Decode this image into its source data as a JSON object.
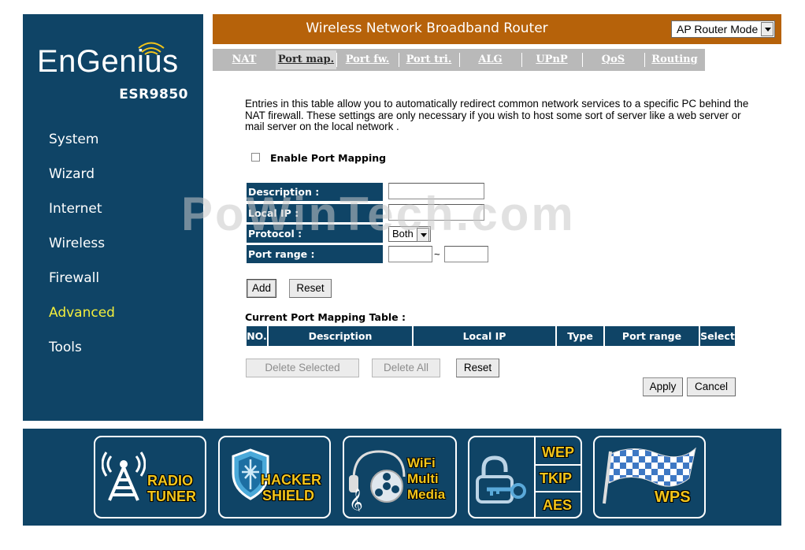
{
  "brand": {
    "logo_text": "EnGenius",
    "model": "ESR9850"
  },
  "header": {
    "title": "Wireless Network Broadband Router",
    "mode": "AP Router Mode"
  },
  "nav": {
    "items": [
      {
        "label": "System",
        "active": false
      },
      {
        "label": "Wizard",
        "active": false
      },
      {
        "label": "Internet",
        "active": false
      },
      {
        "label": "Wireless",
        "active": false
      },
      {
        "label": "Firewall",
        "active": false
      },
      {
        "label": "Advanced",
        "active": true
      },
      {
        "label": "Tools",
        "active": false
      }
    ],
    "active_color": "#f3ee3c"
  },
  "tabs": [
    {
      "label": "NAT",
      "active": false
    },
    {
      "label": "Port map.",
      "active": true
    },
    {
      "label": "Port fw.",
      "active": false
    },
    {
      "label": "Port tri.",
      "active": false
    },
    {
      "label": "ALG",
      "active": false
    },
    {
      "label": "UPnP",
      "active": false
    },
    {
      "label": "QoS",
      "active": false
    },
    {
      "label": "Routing",
      "active": false
    }
  ],
  "content": {
    "intro": "Entries in this table allow you to automatically redirect common network services to a specific PC behind the NAT firewall. These settings are only necessary if you wish to host some sort of server like a web server or mail server on the local network .",
    "enable_label": "Enable Port Mapping",
    "enable_checked": false,
    "form": {
      "description_label": "Description :",
      "description_value": "",
      "local_ip_label": "Local IP :",
      "local_ip_value": "",
      "protocol_label": "Protocol :",
      "protocol_value": "Both",
      "port_range_label": "Port range :",
      "port_from": "",
      "port_tilde": "~",
      "port_to": ""
    },
    "buttons": {
      "add": "Add",
      "reset": "Reset"
    },
    "table": {
      "title": "Current Port Mapping Table :",
      "columns": [
        "NO.",
        "Description",
        "Local IP",
        "Type",
        "Port range",
        "Select"
      ],
      "rows": []
    },
    "table_buttons": {
      "delete_selected": "Delete Selected",
      "delete_all": "Delete All",
      "reset": "Reset"
    },
    "apply": "Apply",
    "cancel": "Cancel"
  },
  "watermark": "PoWinTech.com",
  "footer": {
    "badges": [
      {
        "name": "radio-tuner",
        "lines": [
          "RADIO",
          "TUNER"
        ]
      },
      {
        "name": "hacker-shield",
        "lines": [
          "HACKER",
          "SHIELD"
        ]
      },
      {
        "name": "wifi-multimedia",
        "lines": [
          "WiFi",
          "Multi",
          "Media"
        ]
      },
      {
        "name": "encryption",
        "lines": [
          "WEP",
          "TKIP",
          "AES"
        ]
      },
      {
        "name": "wps",
        "lines": [
          "WPS"
        ]
      }
    ]
  },
  "colors": {
    "navy": "#0f4466",
    "header_orange": "#b6620a",
    "tab_gray": "#b9b9b9",
    "badge_yellow": "#f2c41a"
  }
}
